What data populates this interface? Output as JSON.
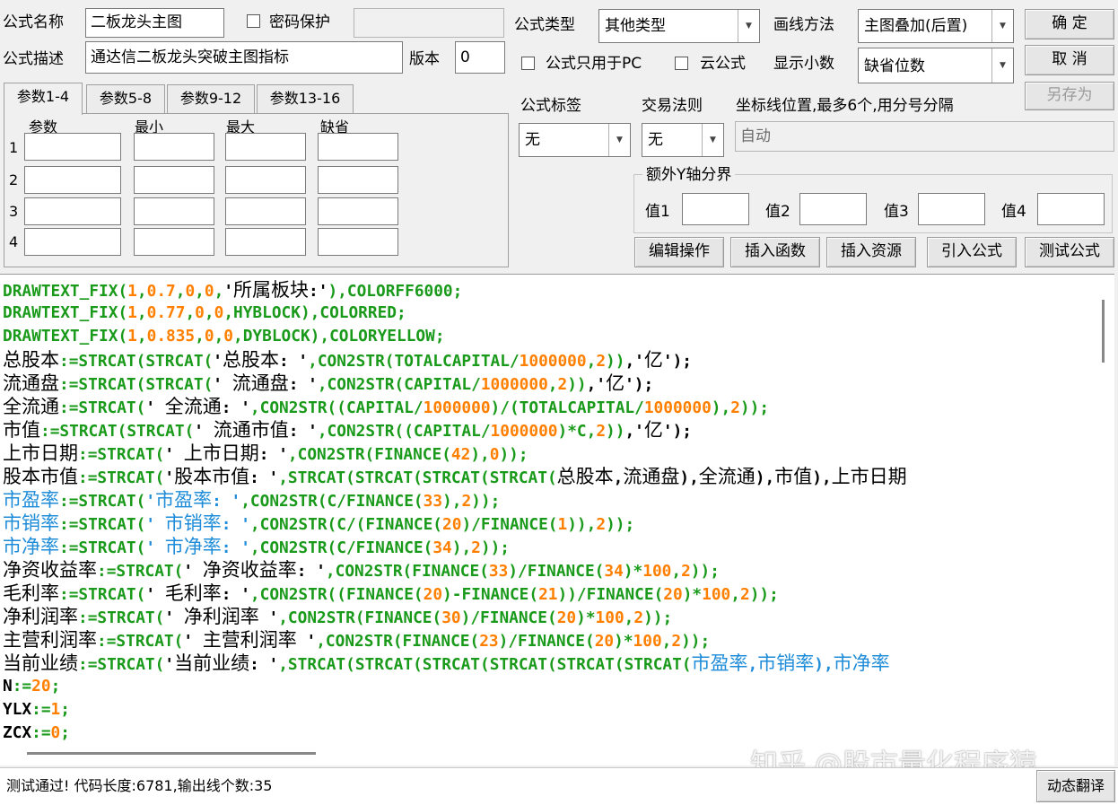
{
  "header": {
    "name_label": "公式名称",
    "name_value": "二板龙头主图",
    "password_label": "密码保护",
    "password_value": "",
    "desc_label": "公式描述",
    "desc_value": "通达信二板龙头突破主图指标",
    "version_label": "版本",
    "version_value": "0",
    "type_label": "公式类型",
    "type_value": "其他类型",
    "draw_label": "画线方法",
    "draw_value": "主图叠加(后置)",
    "pc_only_label": "公式只用于PC",
    "cloud_label": "云公式",
    "decimal_label": "显示小数",
    "decimal_value": "缺省位数",
    "ok_label": "确 定",
    "cancel_label": "取 消",
    "saveas_label": "另存为"
  },
  "params": {
    "tabs": [
      "参数1-4",
      "参数5-8",
      "参数9-12",
      "参数13-16"
    ],
    "columns": [
      "参数",
      "最小",
      "最大",
      "缺省"
    ],
    "rows": [
      "1",
      "2",
      "3",
      "4"
    ]
  },
  "options": {
    "tag_label": "公式标签",
    "tag_value": "无",
    "rule_label": "交易法则",
    "rule_value": "无",
    "axis_label": "坐标线位置,最多6个,用分号分隔",
    "axis_value": "自动",
    "extra_y_label": "额外Y轴分界",
    "value_labels": [
      "值1",
      "值2",
      "值3",
      "值4"
    ]
  },
  "actions": [
    "编辑操作",
    "插入函数",
    "插入资源",
    "引入公式",
    "测试公式"
  ],
  "status": {
    "message": "测试通过! 代码长度:6781,输出线个数:35",
    "translate_label": "动态翻译"
  },
  "watermark": "知乎 @股市量化程序猿",
  "colors": {
    "keyword": "#1a9a1a",
    "number": "#ff8000",
    "variable": "#1e8cd8"
  },
  "code_lines": [
    [
      [
        "g",
        "DRAWTEXT_FIX("
      ],
      [
        "o",
        "1"
      ],
      [
        "g",
        ","
      ],
      [
        "o",
        "0.7"
      ],
      [
        "g",
        ","
      ],
      [
        "o",
        "0"
      ],
      [
        "g",
        ","
      ],
      [
        "o",
        "0"
      ],
      [
        "g",
        ","
      ],
      [
        "k",
        "'所属板块:'"
      ],
      [
        "g",
        "),COLORFF6000;"
      ]
    ],
    [
      [
        "g",
        "DRAWTEXT_FIX("
      ],
      [
        "o",
        "1"
      ],
      [
        "g",
        ","
      ],
      [
        "o",
        "0.77"
      ],
      [
        "g",
        ","
      ],
      [
        "o",
        "0"
      ],
      [
        "g",
        ","
      ],
      [
        "o",
        "0"
      ],
      [
        "g",
        ",HYBLOCK),COLORRED;"
      ]
    ],
    [
      [
        "g",
        "DRAWTEXT_FIX("
      ],
      [
        "o",
        "1"
      ],
      [
        "g",
        ","
      ],
      [
        "o",
        "0.835"
      ],
      [
        "g",
        ","
      ],
      [
        "o",
        "0"
      ],
      [
        "g",
        ","
      ],
      [
        "o",
        "0"
      ],
      [
        "g",
        ",DYBLOCK),COLORYELLOW;"
      ]
    ],
    [
      [
        "c",
        "总股本"
      ],
      [
        "g",
        ":=STRCAT(STRCAT("
      ],
      [
        "k",
        "'总股本: '"
      ],
      [
        "g",
        ",CON2STR(TOTALCAPITAL/"
      ],
      [
        "o",
        "1000000"
      ],
      [
        "g",
        ","
      ],
      [
        "o",
        "2"
      ],
      [
        "g",
        "))"
      ],
      [
        "k",
        ",'亿');"
      ]
    ],
    [
      [
        "c",
        "流通盘"
      ],
      [
        "g",
        ":=STRCAT(STRCAT("
      ],
      [
        "k",
        "' 流通盘: '"
      ],
      [
        "g",
        ",CON2STR(CAPITAL/"
      ],
      [
        "o",
        "1000000"
      ],
      [
        "g",
        ","
      ],
      [
        "o",
        "2"
      ],
      [
        "g",
        "))"
      ],
      [
        "k",
        ",'亿');"
      ]
    ],
    [
      [
        "c",
        "全流通"
      ],
      [
        "g",
        ":=STRCAT("
      ],
      [
        "k",
        "' 全流通: '"
      ],
      [
        "g",
        ",CON2STR((CAPITAL/"
      ],
      [
        "o",
        "1000000"
      ],
      [
        "g",
        ")/(TOTALCAPITAL/"
      ],
      [
        "o",
        "1000000"
      ],
      [
        "g",
        "),"
      ],
      [
        "o",
        "2"
      ],
      [
        "g",
        "));"
      ]
    ],
    [
      [
        "c",
        "市值"
      ],
      [
        "g",
        ":=STRCAT(STRCAT("
      ],
      [
        "k",
        "' 流通市值: '"
      ],
      [
        "g",
        ",CON2STR((CAPITAL/"
      ],
      [
        "o",
        "1000000"
      ],
      [
        "g",
        ")*C,"
      ],
      [
        "o",
        "2"
      ],
      [
        "g",
        "))"
      ],
      [
        "k",
        ",'亿');"
      ]
    ],
    [
      [
        "c",
        "上市日期"
      ],
      [
        "g",
        ":=STRCAT("
      ],
      [
        "k",
        "' 上市日期: '"
      ],
      [
        "g",
        ",CON2STR(FINANCE("
      ],
      [
        "o",
        "42"
      ],
      [
        "g",
        "),"
      ],
      [
        "o",
        "0"
      ],
      [
        "g",
        "));"
      ]
    ],
    [
      [
        "c",
        "股本市值"
      ],
      [
        "g",
        ":=STRCAT("
      ],
      [
        "k",
        "'股本市值: '"
      ],
      [
        "g",
        ",STRCAT(STRCAT(STRCAT(STRCAT("
      ],
      [
        "k",
        "总股本,流通盘),全流通),市值),上市日期"
      ]
    ],
    [
      [
        "b",
        "市盈率"
      ],
      [
        "g",
        ":=STRCAT("
      ],
      [
        "b",
        "'市盈率: '"
      ],
      [
        "g",
        ",CON2STR(C/FINANCE("
      ],
      [
        "o",
        "33"
      ],
      [
        "g",
        "),"
      ],
      [
        "o",
        "2"
      ],
      [
        "g",
        "));"
      ]
    ],
    [
      [
        "b",
        "市销率"
      ],
      [
        "g",
        ":=STRCAT("
      ],
      [
        "b",
        "' 市销率: '"
      ],
      [
        "g",
        ",CON2STR(C/(FINANCE("
      ],
      [
        "o",
        "20"
      ],
      [
        "g",
        ")/FINANCE("
      ],
      [
        "o",
        "1"
      ],
      [
        "g",
        ")),"
      ],
      [
        "o",
        "2"
      ],
      [
        "g",
        "));"
      ]
    ],
    [
      [
        "b",
        "市净率"
      ],
      [
        "g",
        ":=STRCAT("
      ],
      [
        "b",
        "' 市净率: '"
      ],
      [
        "g",
        ",CON2STR(C/FINANCE("
      ],
      [
        "o",
        "34"
      ],
      [
        "g",
        "),"
      ],
      [
        "o",
        "2"
      ],
      [
        "g",
        "));"
      ]
    ],
    [
      [
        "c",
        "净资收益率"
      ],
      [
        "g",
        ":=STRCAT("
      ],
      [
        "k",
        "' 净资收益率: '"
      ],
      [
        "g",
        ",CON2STR(FINANCE("
      ],
      [
        "o",
        "33"
      ],
      [
        "g",
        ")/FINANCE("
      ],
      [
        "o",
        "34"
      ],
      [
        "g",
        ")*"
      ],
      [
        "o",
        "100"
      ],
      [
        "g",
        ","
      ],
      [
        "o",
        "2"
      ],
      [
        "g",
        "));"
      ]
    ],
    [
      [
        "c",
        "毛利率"
      ],
      [
        "g",
        ":=STRCAT("
      ],
      [
        "k",
        "' 毛利率: '"
      ],
      [
        "g",
        ",CON2STR((FINANCE("
      ],
      [
        "o",
        "20"
      ],
      [
        "g",
        ")-FINANCE("
      ],
      [
        "o",
        "21"
      ],
      [
        "g",
        "))/FINANCE("
      ],
      [
        "o",
        "20"
      ],
      [
        "g",
        ")*"
      ],
      [
        "o",
        "100"
      ],
      [
        "g",
        ","
      ],
      [
        "o",
        "2"
      ],
      [
        "g",
        "));"
      ]
    ],
    [
      [
        "c",
        "净利润率"
      ],
      [
        "g",
        ":=STRCAT("
      ],
      [
        "k",
        "' 净利润率 '"
      ],
      [
        "g",
        ",CON2STR(FINANCE("
      ],
      [
        "o",
        "30"
      ],
      [
        "g",
        ")/FINANCE("
      ],
      [
        "o",
        "20"
      ],
      [
        "g",
        ")*"
      ],
      [
        "o",
        "100"
      ],
      [
        "g",
        ","
      ],
      [
        "o",
        "2"
      ],
      [
        "g",
        "));"
      ]
    ],
    [
      [
        "c",
        "主营利润率"
      ],
      [
        "g",
        ":=STRCAT("
      ],
      [
        "k",
        "' 主营利润率 '"
      ],
      [
        "g",
        ",CON2STR(FINANCE("
      ],
      [
        "o",
        "23"
      ],
      [
        "g",
        ")/FINANCE("
      ],
      [
        "o",
        "20"
      ],
      [
        "g",
        ")*"
      ],
      [
        "o",
        "100"
      ],
      [
        "g",
        ","
      ],
      [
        "o",
        "2"
      ],
      [
        "g",
        "));"
      ]
    ],
    [
      [
        "c",
        "当前业绩"
      ],
      [
        "g",
        ":=STRCAT("
      ],
      [
        "k",
        "'当前业绩: '"
      ],
      [
        "g",
        ",STRCAT(STRCAT(STRCAT(STRCAT(STRCAT(STRCAT("
      ],
      [
        "b",
        "市盈率,市销率),市净率"
      ]
    ],
    [
      [
        "k",
        "N"
      ],
      [
        "g",
        ":="
      ],
      [
        "o",
        "20"
      ],
      [
        "g",
        ";"
      ]
    ],
    [
      [
        "k",
        "YLX"
      ],
      [
        "g",
        ":="
      ],
      [
        "o",
        "1"
      ],
      [
        "g",
        ";"
      ]
    ],
    [
      [
        "k",
        "ZCX"
      ],
      [
        "g",
        ":="
      ],
      [
        "o",
        "0"
      ],
      [
        "g",
        ";"
      ]
    ]
  ]
}
